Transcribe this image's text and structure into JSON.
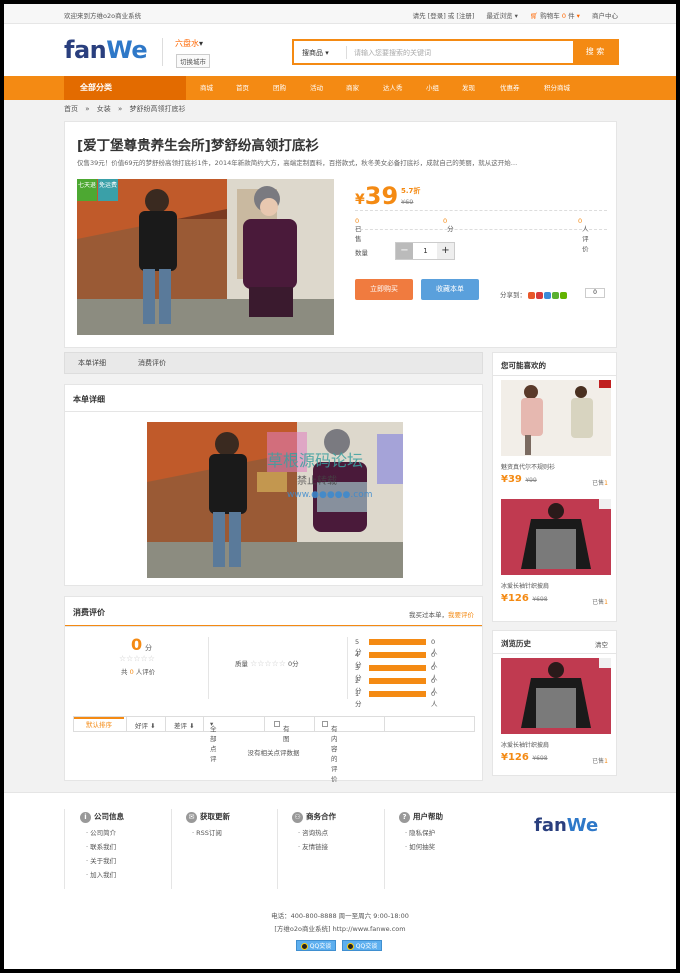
{
  "topbar": {
    "welcome": "欢迎来到方维o2o商业系统",
    "login_links": "请先 [登录] 或 [注册]",
    "recent": "最近浏览",
    "cart_label": "购物车",
    "cart_count": "0",
    "cart_unit": "件",
    "merchant": "商户中心"
  },
  "header": {
    "logo_a": "fan",
    "logo_b": "We",
    "city": "六盘水",
    "switch_city": "切换城市",
    "search_scope": "搜商品",
    "search_placeholder": "请输入您要搜索的关键词",
    "search_button": "搜 索"
  },
  "nav": {
    "all_categories": "全部分类",
    "items": [
      "商城",
      "首页",
      "团购",
      "活动",
      "商家",
      "达人秀",
      "小组",
      "发现",
      "优惠券",
      "积分商城"
    ]
  },
  "breadcrumb": [
    "首页",
    "»",
    "女装",
    "»",
    "梦舒纷高领打底衫"
  ],
  "deal": {
    "title": "[爱丁堡尊贵养生会所]梦舒纷高领打底衫",
    "subtitle": "仅售39元！价值69元的梦舒纷高领打底衫1件，2014年新款简约大方，高端定制面料，百搭款式，秋冬美女必备打底衫，成就自己的美丽，就从这开始…",
    "tag_days": "七天退",
    "tag_shipping": "免运费",
    "price_currency": "¥",
    "price": "39",
    "discount": "5.7折",
    "original_price": "¥69",
    "sold_label": "已售",
    "sold_count": "0",
    "score": "0",
    "score_unit": "分",
    "review_count": "0",
    "review_label": "人评价",
    "qty_label": "数量",
    "qty_minus": "−",
    "qty_value": "1",
    "qty_plus": "+",
    "buy_button": "立即购买",
    "fav_button": "收藏本单",
    "share_label": "分享到：",
    "share_count": "0"
  },
  "tabs": [
    "本单详细",
    "消费评价"
  ],
  "detail": {
    "heading": "本单详细",
    "watermark_a": "草根源码论坛",
    "watermark_b": "禁止转载",
    "watermark_c": "www.●●●●●.com"
  },
  "reviews": {
    "heading": "消费评价",
    "write_prefix": "我买过本单，",
    "write_link": "我要评价",
    "score": "0",
    "score_unit": "分",
    "stars": "☆☆☆☆☆",
    "total_prefix": "共",
    "total_count": "0",
    "total_suffix": "人评价",
    "quality_label": "质量",
    "quality_score": "0分",
    "dist": [
      {
        "label": "5分",
        "count": "0人"
      },
      {
        "label": "4分",
        "count": "0人"
      },
      {
        "label": "3分",
        "count": "0人"
      },
      {
        "label": "2分",
        "count": "0人"
      },
      {
        "label": "1分",
        "count": "0人"
      }
    ],
    "filter_default": "默认排序",
    "filter_good": "好评 ⬇",
    "filter_bad": "差评 ⬇",
    "filter_all": "全部点评",
    "filter_has_pic": "有图",
    "filter_has_content": "有内容的评价",
    "empty_text": "没有相关点评数据"
  },
  "sidebar": {
    "like_title": "您可能喜欢的",
    "like_items": [
      {
        "name": "魅资真代尔不规则衫",
        "price": "¥39",
        "orig": "¥99",
        "sold_label": "已售",
        "sold": "1"
      },
      {
        "name": "冰爱长袖针织披肩",
        "price": "¥126",
        "orig": "¥698",
        "sold_label": "已售",
        "sold": "1"
      }
    ],
    "history_title": "浏览历史",
    "history_clear": "清空",
    "history_items": [
      {
        "name": "冰爱长袖针织披肩",
        "price": "¥126",
        "orig": "¥698",
        "sold_label": "已售",
        "sold": "1"
      }
    ]
  },
  "footer": {
    "cols": [
      {
        "icon": "i",
        "title": "公司信息",
        "links": [
          "公司简介",
          "联系我们",
          "关于我们",
          "加入我们"
        ]
      },
      {
        "icon": "✉",
        "title": "获取更新",
        "links": [
          "RSS订阅"
        ]
      },
      {
        "icon": "⚇",
        "title": "商务合作",
        "links": [
          "咨询热点",
          "友情链接"
        ]
      },
      {
        "icon": "?",
        "title": "用户帮助",
        "links": [
          "隐私保护",
          "如何抽奖"
        ]
      }
    ],
    "logo_a": "fan",
    "logo_b": "We",
    "phone": "电话：400-800-8888 周一至周六 9:00-18:00",
    "copyright": "[方维o2o商业系统] http://www.fanwe.com",
    "qq1": "QQ交谈",
    "qq2": "QQ交谈"
  }
}
